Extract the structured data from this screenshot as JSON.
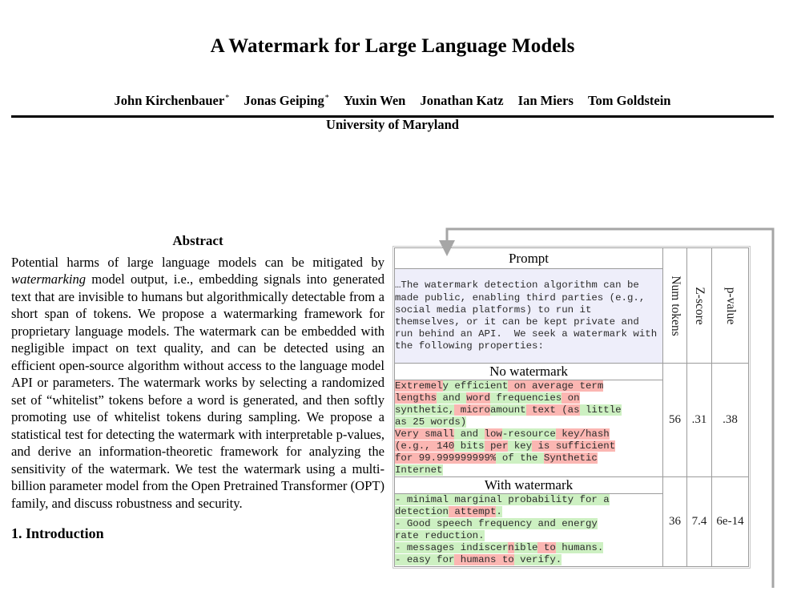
{
  "paper": {
    "title": "A Watermark for Large Language Models",
    "authors": [
      {
        "name": "John Kirchenbauer",
        "star": "*"
      },
      {
        "name": "Jonas Geiping",
        "star": "*"
      },
      {
        "name": "Yuxin Wen",
        "star": ""
      },
      {
        "name": "Jonathan Katz",
        "star": ""
      },
      {
        "name": "Ian Miers",
        "star": ""
      },
      {
        "name": "Tom Goldstein",
        "star": ""
      }
    ],
    "affiliation": "University of Maryland",
    "abstract_heading": "Abstract",
    "abstract_part1": "Potential harms of large language models can be mitigated by ",
    "abstract_italic": "watermarking",
    "abstract_part2": " model output, i.e., embedding signals into generated text that are invisible to humans but algorithmically detectable from a short span of tokens. We propose a watermarking framework for proprietary language models. The watermark can be embedded with negligible impact on text quality, and can be detected using an efficient open-source algorithm without access to the language model API or parameters. The watermark works by selecting a randomized set of “whitelist” tokens before a word is generated, and then softly promoting use of whitelist tokens during sampling. We propose a statistical test for detecting the watermark with interpretable p-values, and derive an information-theoretic framework for analyzing the sensitivity of the watermark. We test the watermark using a multi-billion parameter model from the Open Pretrained Transformer (OPT) family, and discuss robustness and security.",
    "section_heading": "1. Introduction"
  },
  "table": {
    "col_headers": {
      "main": "Prompt",
      "num_tokens": "Num tokens",
      "z_score": "Z-score",
      "p_value": "p-value"
    },
    "prompt_text": "…The watermark detection algorithm can be made public, enabling third parties (e.g., social media platforms) to run it themselves, or it can be kept private and run behind an API.  We seek a watermark with the following properties:",
    "rows": [
      {
        "label": "No watermark",
        "num_tokens": "56",
        "z_score": ".31",
        "p_value": ".38",
        "tokens": [
          {
            "t": "Extremel",
            "h": "r"
          },
          {
            "t": "y efficient",
            "h": "g"
          },
          {
            "t": " on average term\nlengths",
            "h": "r"
          },
          {
            "t": " and ",
            "h": "g"
          },
          {
            "t": "word",
            "h": "r"
          },
          {
            "t": " frequencies",
            "h": "g"
          },
          {
            "t": " on\n",
            "h": "r"
          },
          {
            "t": "synthetic,",
            "h": "g"
          },
          {
            "t": " micro",
            "h": "r"
          },
          {
            "t": "amount",
            "h": "g"
          },
          {
            "t": " text (as",
            "h": "r"
          },
          {
            "t": " little\nas 25 words)",
            "h": "g"
          },
          {
            "t": "\nVery small",
            "h": "r"
          },
          {
            "t": " and ",
            "h": "g"
          },
          {
            "t": "low",
            "h": "r"
          },
          {
            "t": "-resource",
            "h": "g"
          },
          {
            "t": " key/hash\n(e.g., 140",
            "h": "r"
          },
          {
            "t": " bits",
            "h": "g"
          },
          {
            "t": " per",
            "h": "r"
          },
          {
            "t": " key",
            "h": "g"
          },
          {
            "t": " is sufficient\nfor 99.",
            "h": "r"
          },
          {
            "t": "999999999%",
            "h": "r"
          },
          {
            "t": " of the ",
            "h": "g"
          },
          {
            "t": "Synthetic\n",
            "h": "r"
          },
          {
            "t": "Internet",
            "h": "g"
          }
        ]
      },
      {
        "label": "With watermark",
        "num_tokens": "36",
        "z_score": "7.4",
        "p_value": "6e-14",
        "tokens": [
          {
            "t": "- minimal marginal probability for a\ndetection",
            "h": "g"
          },
          {
            "t": " attempt",
            "h": "r"
          },
          {
            "t": ".\n",
            "h": "g"
          },
          {
            "t": "- Good speech frequency and energy\nrate reduction.\n",
            "h": "g"
          },
          {
            "t": "- messages indiscer",
            "h": "g"
          },
          {
            "t": "n",
            "h": "r"
          },
          {
            "t": "ible",
            "h": "g"
          },
          {
            "t": " to",
            "h": "r"
          },
          {
            "t": " humans.\n",
            "h": "g"
          },
          {
            "t": "- easy for",
            "h": "g"
          },
          {
            "t": " humans to",
            "h": "r"
          },
          {
            "t": " verify.",
            "h": "g"
          }
        ]
      }
    ]
  },
  "annotations": {
    "callout_arrow": "arrow-pointing-to-prompt-cell"
  },
  "colors": {
    "whitelist_highlight": "#cdf0c2",
    "blacklist_highlight": "#fbb6b2",
    "prompt_background": "#eeeefa",
    "table_border": "#9b9b9b",
    "arrow": "#a6a6a6"
  }
}
